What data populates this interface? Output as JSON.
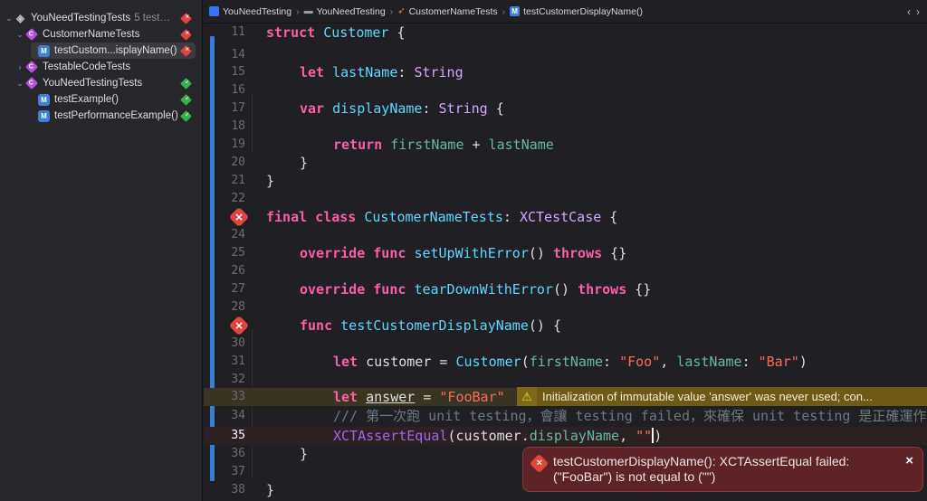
{
  "navigator": {
    "items": [
      {
        "label": "YouNeedTestingTests",
        "sub": "5 tests...",
        "status": "fail",
        "kind": "plan"
      },
      {
        "label": "CustomerNameTests",
        "status": "fail",
        "kind": "class"
      },
      {
        "label": "testCustom...isplayName()",
        "status": "fail",
        "kind": "method"
      },
      {
        "label": "TestableCodeTests",
        "kind": "class"
      },
      {
        "label": "YouNeedTestingTests",
        "status": "pass",
        "kind": "class"
      },
      {
        "label": "testExample()",
        "status": "pass",
        "kind": "method"
      },
      {
        "label": "testPerformanceExample()",
        "status": "pass",
        "kind": "method"
      }
    ]
  },
  "jumpbar": {
    "crumbs": [
      "YouNeedTesting",
      "YouNeedTesting",
      "CustomerNameTests",
      "testCustomerDisplayName()"
    ]
  },
  "editor": {
    "lines": [
      {
        "n": "11"
      },
      {
        "n": "14"
      },
      {
        "n": "15"
      },
      {
        "n": "16"
      },
      {
        "n": "17"
      },
      {
        "n": "18"
      },
      {
        "n": "19"
      },
      {
        "n": "20"
      },
      {
        "n": "21"
      },
      {
        "n": "22"
      },
      {
        "n": "23"
      },
      {
        "n": "24"
      },
      {
        "n": "25"
      },
      {
        "n": "26"
      },
      {
        "n": "27"
      },
      {
        "n": "28"
      },
      {
        "n": "29"
      },
      {
        "n": "30"
      },
      {
        "n": "31"
      },
      {
        "n": "32"
      },
      {
        "n": "33"
      },
      {
        "n": "34"
      },
      {
        "n": "35"
      },
      {
        "n": "36"
      },
      {
        "n": "37"
      },
      {
        "n": "38"
      }
    ],
    "tokens": {
      "struct": "struct",
      "customer_type": "Customer",
      "open_brace": " {",
      "let": "let",
      "lastName": "lastName",
      "colon_string": ": ",
      "String": "String",
      "var": "var",
      "displayName": "displayName",
      "return": "return",
      "firstName_plus": "firstName",
      "plus": " + ",
      "lastName2": "lastName",
      "close_brace": "}",
      "final_class": "final class",
      "CustomerNameTests": "CustomerNameTests",
      "XCTestCase": "XCTestCase",
      "override_func": "override func",
      "setUp": "setUpWithError",
      "parens": "()",
      "throws": "throws",
      "empty_braces": " {}",
      "tearDown": "tearDownWithError",
      "func": "func",
      "testName": "testCustomerDisplayName",
      "customer_var": "customer",
      "equals": " = ",
      "init_open": "(",
      "firstName_label": "firstName",
      "label_colon": ": ",
      "foo_str": "\"Foo\"",
      "comma": ", ",
      "lastName_label": "lastName",
      "bar_str": "\"Bar\"",
      "init_close": ")",
      "answer_var": "answer",
      "foobar_str": "\"FooBar\"",
      "comment": "/// 第一次跑 unit testing，會讓 testing failed，來確保 unit testing 是正確運作的",
      "xct": "XCTAssertEqual",
      "customer_dot": "customer.",
      "displayName2": "displayName",
      "empty_str_open": "\"\"",
      "call_close": ")"
    },
    "warning": "Initialization of immutable value 'answer' was never used; con...",
    "error_popup": "testCustomerDisplayName(): XCTAssertEqual failed: (\"FooBar\") is not equal to (\"\")"
  },
  "colors": {
    "error": "#e1443b",
    "pass": "#35b24c",
    "keyword": "#fc5fa3",
    "string": "#fc6a5d",
    "warning_bg": "#6e5a17"
  }
}
